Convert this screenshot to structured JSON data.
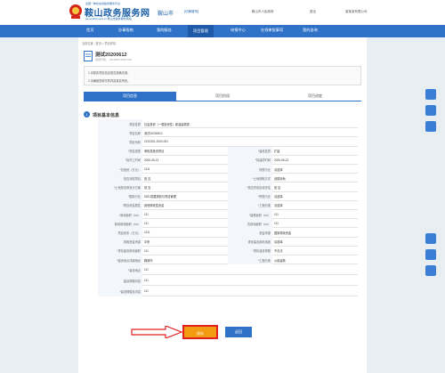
{
  "header": {
    "top_tagline": "全国一体化在线政务服务平台",
    "title": "鞍山政务服务网",
    "subtitle": "gsj.anshan.gov.cn 鞍山市政务服务网站",
    "city": "鞍山市",
    "city_switch": "[切换城市]",
    "user_org": "鞍山市人民政府",
    "user_name": "退出",
    "user_company": "某某某有限公司"
  },
  "nav": [
    "首页",
    "办事指南",
    "我的服务",
    "项目管理",
    "申报中心",
    "在线审批事项",
    "我的咨询"
  ],
  "breadcrumb": "当前位置 : 首页 > 项目详情",
  "project": {
    "title": "测试20200612",
    "code": "项目代码： 2210301-2020-001"
  },
  "notice": {
    "line1": "1.请核实项目信息是否准确无误。",
    "line2": "2.请确保您填写的内容真实有效。"
  },
  "tabs": [
    "项目信息",
    "项目阶段",
    "项目进度"
  ],
  "section_title": "项目基本信息",
  "form": {
    "rows": [
      {
        "l1": "项目性质",
        "v1": "社会投资（一般投资性）新建建筑类"
      },
      {
        "l1": "项目名称",
        "v1": "测试20200612"
      },
      {
        "l1": "项目代码",
        "v1": "2210301-2020-001"
      },
      {
        "l1": "*项目类型",
        "v1": "审批类投资项目",
        "l2": "*建设性质",
        "v2": "扩建"
      },
      {
        "l1": "*拟开工时间",
        "v1": "2020-06-12",
        "l2": "*拟建成时间",
        "v2": "2020-06-12"
      },
      {
        "l1": "*总投资（万元）",
        "v1": "1111",
        "l2": "所属行业",
        "v2": "请选择"
      },
      {
        "l1": "是否涉密项目",
        "v1": "是  否",
        "l2": "*土地获取方式",
        "v2": "划拨用地"
      },
      {
        "l1": "*土地是否带设计方案",
        "v1": "是  否",
        "l2": "*是否完成区域评估",
        "v2": "是  否"
      },
      {
        "l1": "*国标行业",
        "v1": "9251发展规划与项目管理",
        "l2": "*所属行业",
        "v2": "请选择"
      },
      {
        "l1": "*项目资金属性",
        "v1": "其他财政性资金",
        "l2": "*工程分类",
        "v2": "请选择"
      },
      {
        "l1": "*用地面积（m²）",
        "v1": "111",
        "l2": "*建筑面积（m²）",
        "v2": "111"
      },
      {
        "l1": "新增用地面积（m²）",
        "v1": "111",
        "l2": "农用地面积（m²）",
        "v2": "111"
      },
      {
        "l1": "项目资本（万元）",
        "v1": "1111",
        "l2": "资金来源",
        "v2": "国家财政资金"
      },
      {
        "l1": "财政资金来源",
        "v1": "中央",
        "l2": "重化建设用地用途",
        "v2": "请选择"
      },
      {
        "l1": "*重化建设用地面积",
        "v1": "111",
        "l2": "*重化建设规模",
        "v2": "不合法"
      },
      {
        "l1": "*建设地点详细地址",
        "v1": "鞍城市",
        "l2": "*工程分类",
        "v2": "公用建筑"
      },
      {
        "l1": "*建设地点",
        "v1": "111"
      },
      {
        "l1": "建设规模内容",
        "v1": "111"
      },
      {
        "l1": "*建设规模及内容",
        "v1": "111"
      }
    ]
  },
  "buttons": {
    "save": "保存",
    "back": "返回"
  }
}
